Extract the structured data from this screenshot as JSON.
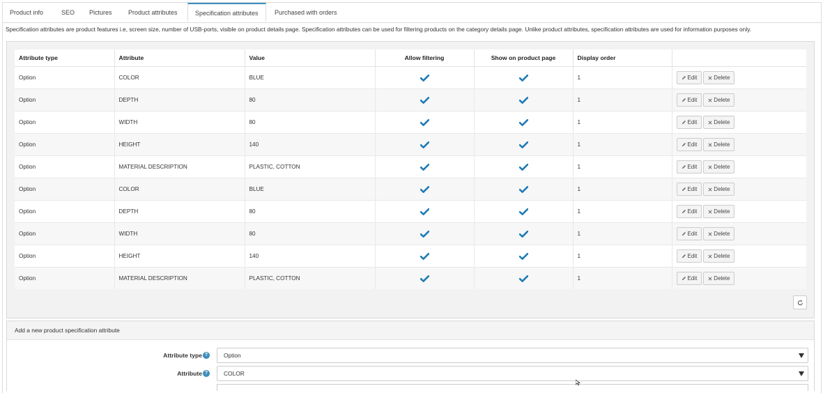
{
  "tabs": [
    {
      "label": "Product info"
    },
    {
      "label": "SEO"
    },
    {
      "label": "Pictures"
    },
    {
      "label": "Product attributes"
    },
    {
      "label": "Specification attributes",
      "active": true
    },
    {
      "label": "Purchased with orders"
    }
  ],
  "description": "Specification attributes are product features i.e, screen size, number of USB-ports, visible on product details page. Specification attributes can be used for filtering products on the category details page. Unlike product attributes, specification attributes are used for information purposes only.",
  "grid": {
    "columns": [
      "Attribute type",
      "Attribute",
      "Value",
      "Allow filtering",
      "Show on product page",
      "Display order",
      ""
    ],
    "rows": [
      {
        "type": "Option",
        "attribute": "COLOR",
        "value": "BLUE",
        "allow_filtering": true,
        "show_on_page": true,
        "display_order": "1"
      },
      {
        "type": "Option",
        "attribute": "DEPTH",
        "value": "80",
        "allow_filtering": true,
        "show_on_page": true,
        "display_order": "1"
      },
      {
        "type": "Option",
        "attribute": "WIDTH",
        "value": "80",
        "allow_filtering": true,
        "show_on_page": true,
        "display_order": "1"
      },
      {
        "type": "Option",
        "attribute": "HEIGHT",
        "value": "140",
        "allow_filtering": true,
        "show_on_page": true,
        "display_order": "1"
      },
      {
        "type": "Option",
        "attribute": "MATERIAL DESCRIPTION",
        "value": "PLASTIC, COTTON",
        "allow_filtering": true,
        "show_on_page": true,
        "display_order": "1"
      },
      {
        "type": "Option",
        "attribute": "COLOR",
        "value": "BLUE",
        "allow_filtering": true,
        "show_on_page": true,
        "display_order": "1"
      },
      {
        "type": "Option",
        "attribute": "DEPTH",
        "value": "80",
        "allow_filtering": true,
        "show_on_page": true,
        "display_order": "1"
      },
      {
        "type": "Option",
        "attribute": "WIDTH",
        "value": "80",
        "allow_filtering": true,
        "show_on_page": true,
        "display_order": "1"
      },
      {
        "type": "Option",
        "attribute": "HEIGHT",
        "value": "140",
        "allow_filtering": true,
        "show_on_page": true,
        "display_order": "1"
      },
      {
        "type": "Option",
        "attribute": "MATERIAL DESCRIPTION",
        "value": "PLASTIC, COTTON",
        "allow_filtering": true,
        "show_on_page": true,
        "display_order": "1"
      }
    ],
    "edit_label": "Edit",
    "delete_label": "Delete"
  },
  "add_panel": {
    "title": "Add a new product specification attribute",
    "fields": [
      {
        "label": "Attribute type",
        "value": "Option"
      },
      {
        "label": "Attribute",
        "value": "COLOR"
      }
    ]
  },
  "colors": {
    "accent": "#3c8dbc",
    "check": "#1f7bb6"
  },
  "icons": {
    "check": "checkmark-icon",
    "edit": "pencil-icon",
    "delete": "x-icon",
    "help": "question-circle-icon",
    "refresh": "refresh-icon",
    "dropdown": "caret-down-icon"
  }
}
